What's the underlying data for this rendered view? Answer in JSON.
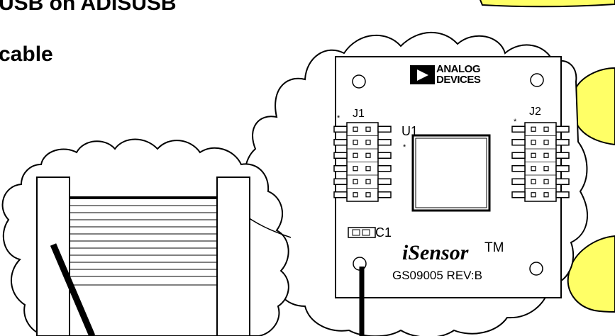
{
  "headings": {
    "line1": "USB on ADISUSB",
    "line2": "cable"
  },
  "board": {
    "brand_line1": "ANALOG",
    "brand_line2": "DEVICES",
    "connector_left": "J1",
    "connector_right": "J2",
    "chip": "U1",
    "capacitor": "C1",
    "pin1_marker": "*",
    "product_name": "iSensor",
    "trademark": "TM",
    "part_number": "GS09005 REV:B"
  },
  "colors": {
    "callout_fill": "#ffff66",
    "outline": "#000000",
    "background": "#ffffff"
  }
}
